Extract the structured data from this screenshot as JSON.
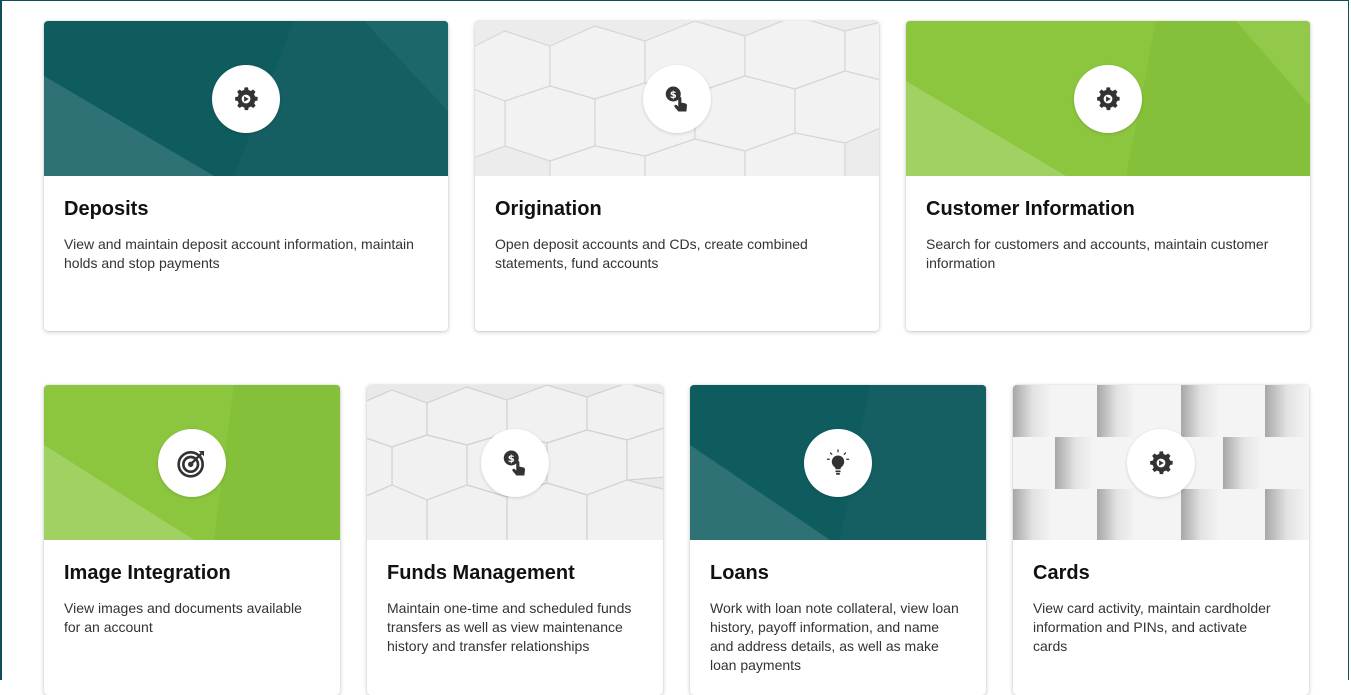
{
  "cards": [
    {
      "title": "Deposits",
      "description": "View and maintain deposit account information, maintain holds and stop payments",
      "icon": "gear-icon",
      "banner_style": "dark-teal"
    },
    {
      "title": "Origination",
      "description": "Open deposit accounts and CDs, create combined statements, fund accounts",
      "icon": "dollar-hand-icon",
      "banner_style": "gray-hexagons"
    },
    {
      "title": "Customer Information",
      "description": "Search for customers and accounts, maintain customer information",
      "icon": "gear-icon",
      "banner_style": "lime-green"
    },
    {
      "title": "Image Integration",
      "description": "View images and documents available for an account",
      "icon": "target-icon",
      "banner_style": "lime-green"
    },
    {
      "title": "Funds Management",
      "description": "Maintain one-time and scheduled funds transfers as well as view maintenance history and transfer relationships",
      "icon": "dollar-hand-icon",
      "banner_style": "gray-hexagons"
    },
    {
      "title": "Loans",
      "description": "Work with loan note collateral, view loan history, payoff information, and name and address details, as well as make loan payments",
      "icon": "lightbulb-icon",
      "banner_style": "dark-teal"
    },
    {
      "title": "Cards",
      "description": "View card activity, maintain cardholder information and PINs, and activate cards",
      "icon": "gear-icon",
      "banner_style": "gray-checker"
    }
  ],
  "colors": {
    "dark_teal": "#0f5c5f",
    "lime_green": "#8cc63f",
    "frame_border": "#0d4f55"
  }
}
